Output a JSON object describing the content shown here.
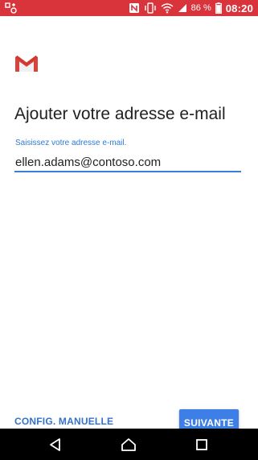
{
  "status_bar": {
    "battery_percent": "86 %",
    "time": "08:20",
    "icons": [
      "notification-icon",
      "nfc-icon",
      "vibrate-icon",
      "wifi-icon",
      "signal-icon",
      "battery-icon"
    ]
  },
  "screen": {
    "logo": "gmail-logo",
    "title": "Ajouter votre adresse e-mail",
    "input_label": "Saisissez votre adresse e-mail.",
    "email_value": "ellen.adams@contoso.com"
  },
  "actions": {
    "manual_config": "CONFIG. MANUELLE",
    "next": "SUIVANTE"
  },
  "nav_bar": {
    "icons": [
      "back-icon",
      "home-icon",
      "recents-icon"
    ]
  },
  "colors": {
    "status_bar": "#d9333b",
    "accent": "#3d7fe6",
    "text_primary": "#202124",
    "nav_bar": "#000000"
  }
}
